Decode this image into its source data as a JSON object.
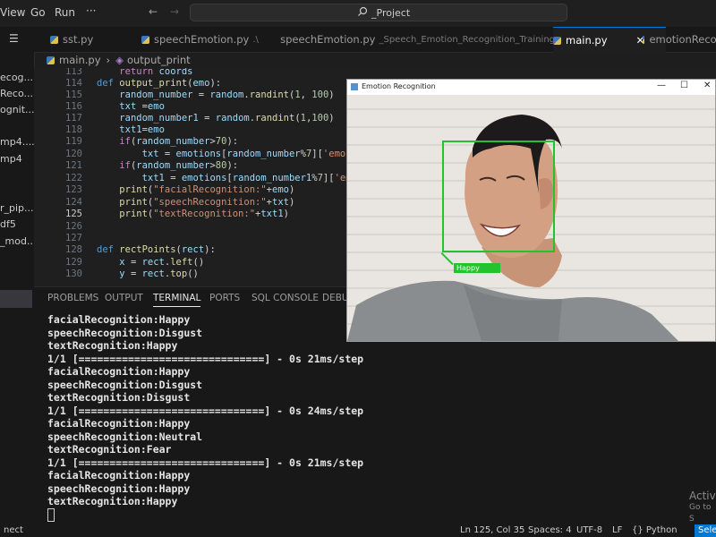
{
  "menubar": {
    "items": [
      "View",
      "Go",
      "Run"
    ],
    "more": "···"
  },
  "search": {
    "placeholder": "_Project"
  },
  "sidebar": {
    "items": [
      "ecog...",
      "Reco...",
      "ognit...",
      "",
      "mp4....",
      "mp4",
      "",
      "r_pip...",
      "df5",
      "_mod...",
      ""
    ]
  },
  "tabs": [
    {
      "label": "sst.py",
      "sub": ""
    },
    {
      "label": "speechEmotion.py",
      "sub": ".\\"
    },
    {
      "label": "speechEmotion.py",
      "sub": "_Speech_Emotion_Recognition_Training"
    },
    {
      "label": "main.py",
      "sub": ""
    },
    {
      "label": "emotionRecog",
      "sub": ""
    }
  ],
  "tab_close": "✕",
  "breadcrumb": {
    "file": "main.py",
    "symbol": "output_print"
  },
  "editor": {
    "line_numbers": [
      "113",
      "114",
      "115",
      "116",
      "117",
      "118",
      "119",
      "120",
      "121",
      "122",
      "123",
      "124",
      "125",
      "126",
      "127",
      "128",
      "129",
      "130"
    ],
    "current_line": "125"
  },
  "panel": {
    "tabs": [
      "PROBLEMS",
      "OUTPUT",
      "TERMINAL",
      "PORTS",
      "SQL CONSOLE",
      "DEBUG"
    ],
    "active_tab": "TERMINAL",
    "terminal_lines": [
      "facialRecognition:Happy",
      "speechRecognition:Disgust",
      "textRecognition:Happy",
      "1/1 [==============================] - 0s 21ms/step",
      "facialRecognition:Happy",
      "speechRecognition:Disgust",
      "textRecognition:Disgust",
      "1/1 [==============================] - 0s 24ms/step",
      "facialRecognition:Happy",
      "speechRecognition:Neutral",
      "textRecognition:Fear",
      "1/1 [==============================] - 0s 21ms/step",
      "facialRecognition:Happy",
      "speechRecognition:Happy",
      "textRecognition:Happy"
    ]
  },
  "status": {
    "remote": "nect",
    "position": "Ln 125, Col 35",
    "spaces": "Spaces: 4",
    "encoding": "UTF-8",
    "eol": "LF",
    "language": "{} Python",
    "select": "Selec"
  },
  "activate_windows": {
    "line1": "Activ",
    "line2": "Go to S"
  },
  "emotion_window": {
    "title": "Emotion Recognition",
    "min": "—",
    "max": "☐",
    "close": "✕",
    "face_label": "Happy",
    "accent": "#22c32d"
  }
}
